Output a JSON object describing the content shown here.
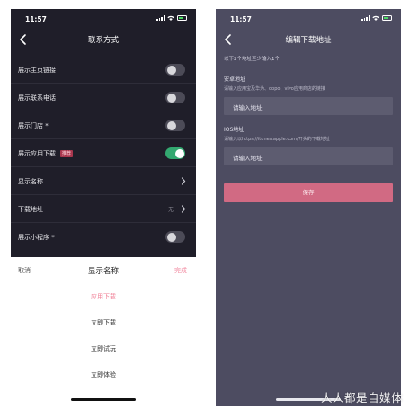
{
  "left_screen": {
    "status": {
      "time": "11:57"
    },
    "nav": {
      "title": "联系方式"
    },
    "settings": [
      {
        "label": "展示主页链接",
        "control": "toggle",
        "state": "off"
      },
      {
        "label": "展示联系电话",
        "control": "toggle",
        "state": "off"
      },
      {
        "label": "展示门店 *",
        "control": "toggle",
        "state": "off"
      },
      {
        "label": "展示应用下载",
        "badge": "推荐",
        "control": "toggle",
        "state": "on"
      },
      {
        "label": "显示名称",
        "control": "chevron"
      },
      {
        "label": "下载地址",
        "value": "无",
        "control": "chevron"
      },
      {
        "label": "展示小程序 *",
        "control": "toggle",
        "state": "off"
      }
    ],
    "picker": {
      "cancel_label": "取消",
      "title": "显示名称",
      "done_label": "完成",
      "options": [
        "应用下载",
        "立即下载",
        "立即试玩",
        "立即体验"
      ],
      "selected": "应用下载"
    }
  },
  "right_screen": {
    "status": {
      "time": "11:57"
    },
    "nav": {
      "title": "编辑下载地址"
    },
    "hint": "以下2个地址至少输入1个",
    "android": {
      "label": "安卓地址",
      "description": "请输入应用宝及华为、oppo、vivo应用商店的链接",
      "placeholder": "请输入地址"
    },
    "ios": {
      "label": "IOS地址",
      "description": "请输入以https://itunes.apple.com/开头的下载地址",
      "placeholder": "请输入地址"
    },
    "save_label": "保存"
  },
  "watermark": {
    "text": "人人都是自媒体",
    "url": "www.woshipm.cn"
  },
  "colors": {
    "left_dark_bg": "#1f1e29",
    "right_bg": "#4d4c61",
    "toggle_on": "#33a870",
    "accent_pink": "#d16a83",
    "picker_selected": "#f07f96"
  }
}
